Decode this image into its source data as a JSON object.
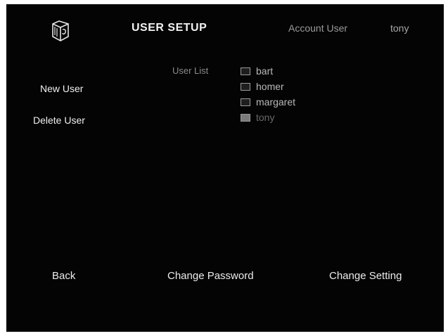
{
  "header": {
    "logo_icon": "box-logo-icon",
    "title": "USER SETUP",
    "account_label": "Account User",
    "account_name": "tony"
  },
  "sidebar": {
    "new_user": "New User",
    "delete_user": "Delete User"
  },
  "user_list": {
    "label": "User List",
    "users": [
      {
        "name": "bart",
        "checked": false
      },
      {
        "name": "homer",
        "checked": false
      },
      {
        "name": "margaret",
        "checked": false
      },
      {
        "name": "tony",
        "checked": true
      }
    ]
  },
  "footer": {
    "back": "Back",
    "change_password": "Change Password",
    "change_setting": "Change Setting"
  },
  "colors": {
    "background": "#040404",
    "text": "#f0f0f0",
    "muted_text": "#9a9a9a"
  }
}
